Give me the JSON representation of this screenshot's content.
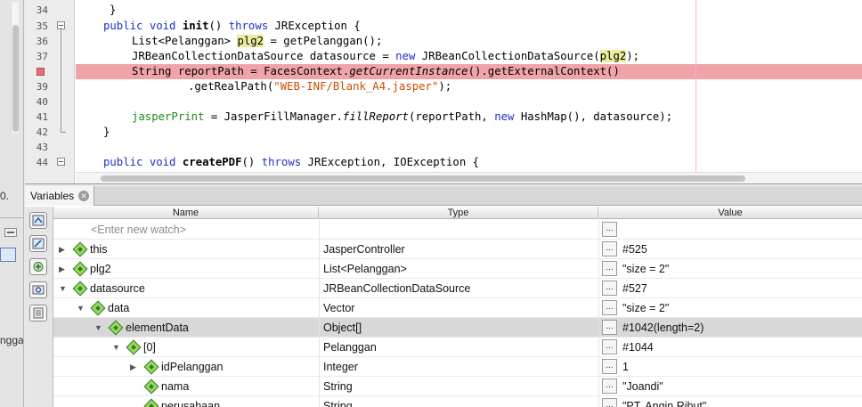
{
  "left_panel": {
    "fragment_top": "0.",
    "fragment_bottom": "ngga"
  },
  "editor": {
    "lines": [
      {
        "num": "34",
        "code": "}"
      },
      {
        "num": "35",
        "code": "public void init() throws JRException {"
      },
      {
        "num": "36",
        "code": "List<Pelanggan> plg2 = getPelanggan();"
      },
      {
        "num": "37",
        "code": "JRBeanCollectionDataSource datasource = new JRBeanCollectionDataSource(plg2);"
      },
      {
        "num": "",
        "code": "String reportPath = FacesContext.getCurrentInstance().getExternalContext()"
      },
      {
        "num": "39",
        "code": ".getRealPath(\"WEB-INF/Blank_A4.jasper\");"
      },
      {
        "num": "40",
        "code": ""
      },
      {
        "num": "41",
        "code": "jasperPrint = JasperFillManager.fillReport(reportPath, new HashMap(), datasource);"
      },
      {
        "num": "42",
        "code": "}"
      },
      {
        "num": "43",
        "code": ""
      },
      {
        "num": "44",
        "code": "public void createPDF() throws JRException, IOException {"
      }
    ]
  },
  "variables": {
    "tab_label": "Variables",
    "columns": {
      "name": "Name",
      "type": "Type",
      "value": "Value"
    },
    "watch_placeholder": "<Enter new watch>",
    "value_button": "...",
    "rows": [
      {
        "name": "this",
        "type": "JasperController",
        "value": "#525",
        "expander": "▶"
      },
      {
        "name": "plg2",
        "type": "List<Pelanggan>",
        "value": "\"size = 2\"",
        "expander": "▶"
      },
      {
        "name": "datasource",
        "type": "JRBeanCollectionDataSource",
        "value": "#527",
        "expander": "▼"
      },
      {
        "name": "data",
        "type": "Vector",
        "value": "\"size = 2\"",
        "expander": "▼"
      },
      {
        "name": "elementData",
        "type": "Object[]",
        "value": "#1042(length=2)",
        "expander": "▼"
      },
      {
        "name": "[0]",
        "type": "Pelanggan",
        "value": "#1044",
        "expander": "▼"
      },
      {
        "name": "idPelanggan",
        "type": "Integer",
        "value": "1",
        "expander": "▶"
      },
      {
        "name": "nama",
        "type": "String",
        "value": "\"Joandi\"",
        "expander": ""
      },
      {
        "name": "perusahaan",
        "type": "String",
        "value": "\"PT. Angin Ribut\"",
        "expander": ""
      }
    ]
  },
  "colors": {
    "breakpoint_line": "#f0a4a8",
    "keyword": "#2030c8",
    "string": "#c85000",
    "field": "#1d8a1d",
    "selected_row": "#d8d8d8",
    "variable_diamond": "#9ad85a"
  },
  "icons": {
    "tab_close": "close-icon",
    "toolbar": [
      "watch-icon",
      "watch-edit-icon",
      "new-watch-icon",
      "settings-icon",
      "report-icon"
    ]
  }
}
